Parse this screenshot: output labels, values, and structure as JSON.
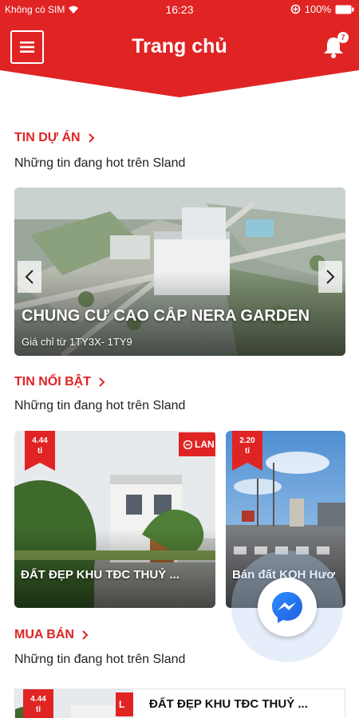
{
  "status_bar": {
    "carrier": "Không có SIM",
    "time": "16:23",
    "battery": "100%"
  },
  "header": {
    "title": "Trang chủ",
    "notification_count": "7",
    "brand_color": "#e02424"
  },
  "sections": {
    "projects": {
      "title": "TIN DỰ ÁN",
      "subtitle": "Những tin đang hot trên Sland",
      "slide": {
        "title": "CHUNG CƯ CAO CẤP NERA GARDEN",
        "price": "Giá chỉ từ 1TY3X- 1TY9"
      }
    },
    "featured": {
      "title": "TIN NỔI BẬT",
      "subtitle": "Những tin đang hot trên Sland",
      "cards": [
        {
          "price": "4.44",
          "unit": "tỉ",
          "title": "ĐẤT ĐẸP KHU TĐC THUỶ ...",
          "logo": "LAN"
        },
        {
          "price": "2.20",
          "unit": "tỉ",
          "title": "Bán đất KQH Hươ"
        }
      ]
    },
    "sale": {
      "title": "MUA BÁN",
      "subtitle": "Những tin đang hot trên Sland",
      "items": [
        {
          "price": "4.44",
          "unit": "tỉ",
          "title": "ĐẤT ĐẸP KHU TĐC THUỶ ...",
          "logo": "L"
        }
      ]
    }
  },
  "icons": {
    "menu": "hamburger-icon",
    "notification": "bell-icon",
    "messenger": "messenger-icon",
    "prev": "chevron-left-icon",
    "next": "chevron-right-icon"
  }
}
